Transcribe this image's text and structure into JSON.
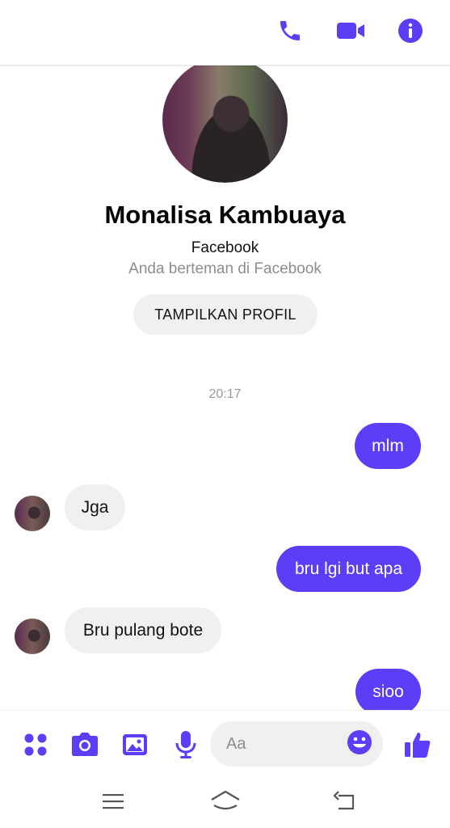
{
  "theme": {
    "accent": "#5b3ef5",
    "bubble_in": "#f0f0f0",
    "muted": "#8a8d91"
  },
  "header": {
    "icons": [
      "phone-icon",
      "video-camera-icon",
      "info-icon"
    ]
  },
  "profile": {
    "name": "Monalisa Kambuaya",
    "line1": "Facebook",
    "line2": "Anda berteman di Facebook",
    "button_label": "TAMPILKAN PROFIL"
  },
  "conversation": {
    "timestamp": "20:17",
    "messages": [
      {
        "from": "me",
        "text": "mlm"
      },
      {
        "from": "them",
        "text": "Jga"
      },
      {
        "from": "me",
        "text": "bru lgi but apa"
      },
      {
        "from": "them",
        "text": "Bru pulang bote"
      },
      {
        "from": "me",
        "text": "sioo"
      }
    ]
  },
  "composer": {
    "placeholder": "Aa",
    "icons": [
      "apps-icon",
      "camera-icon",
      "gallery-icon",
      "microphone-icon",
      "emoji-icon",
      "thumbs-up-icon"
    ]
  },
  "system_nav": {
    "icons": [
      "menu-icon",
      "home-icon",
      "back-icon"
    ]
  }
}
